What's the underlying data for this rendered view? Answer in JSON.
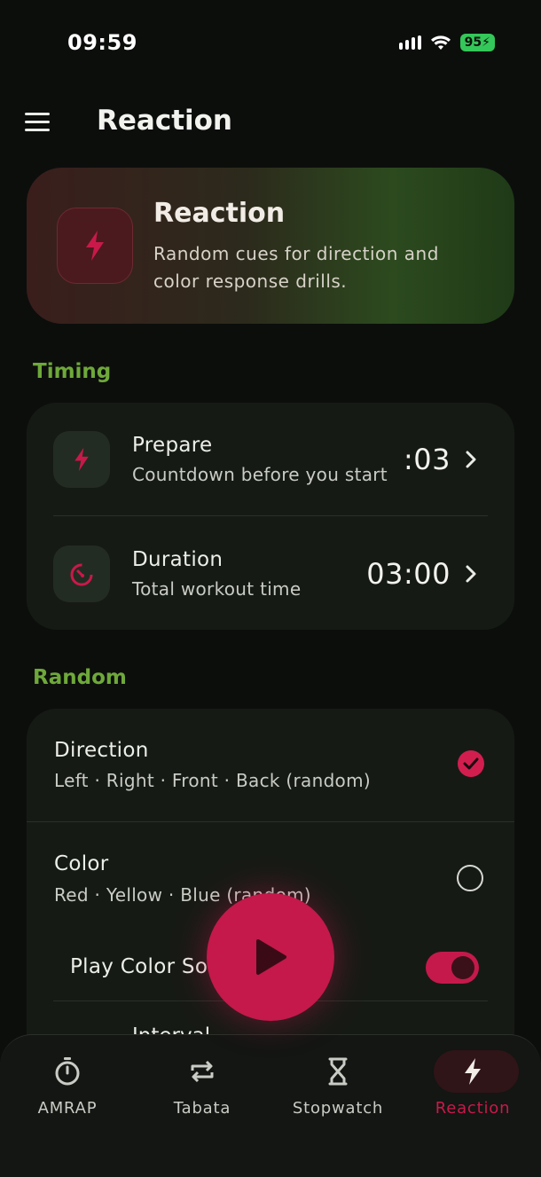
{
  "status_bar": {
    "time": "09:59",
    "battery": "95"
  },
  "app_bar": {
    "title": "Reaction",
    "menu_icon": "hamburger-menu-icon"
  },
  "hero": {
    "title": "Reaction",
    "description": "Random cues for direction and color response drills.",
    "icon": "lightning-bolt-icon"
  },
  "timing": {
    "section_label": "Timing",
    "rows": [
      {
        "title": "Prepare",
        "subtitle": "Countdown before you start",
        "value": ":03",
        "icon": "lightning-bolt-icon"
      },
      {
        "title": "Duration",
        "subtitle": "Total workout time",
        "value": "03:00",
        "icon": "timer-icon"
      }
    ]
  },
  "random": {
    "section_label": "Random",
    "options": [
      {
        "title": "Direction",
        "subtitle": "Left · Right · Front · Back (random)",
        "selected": true
      },
      {
        "title": "Color",
        "subtitle": "Red · Yellow · Blue (random)",
        "selected": false
      }
    ],
    "play_color_sound": {
      "label": "Play Color Sound",
      "enabled": true
    },
    "interval_label": "Interval"
  },
  "fab": {
    "icon": "play-icon"
  },
  "bottom_nav": {
    "items": [
      {
        "label": "AMRAP",
        "icon": "stopwatch-icon",
        "active": false
      },
      {
        "label": "Tabata",
        "icon": "repeat-icon",
        "active": false
      },
      {
        "label": "Stopwatch",
        "icon": "hourglass-icon",
        "active": false
      },
      {
        "label": "Reaction",
        "icon": "lightning-bolt-icon",
        "active": true
      }
    ]
  },
  "colors": {
    "accent": "#c4194a",
    "section": "#6ea83a",
    "background": "#0c0e0c",
    "card": "#161a15"
  }
}
